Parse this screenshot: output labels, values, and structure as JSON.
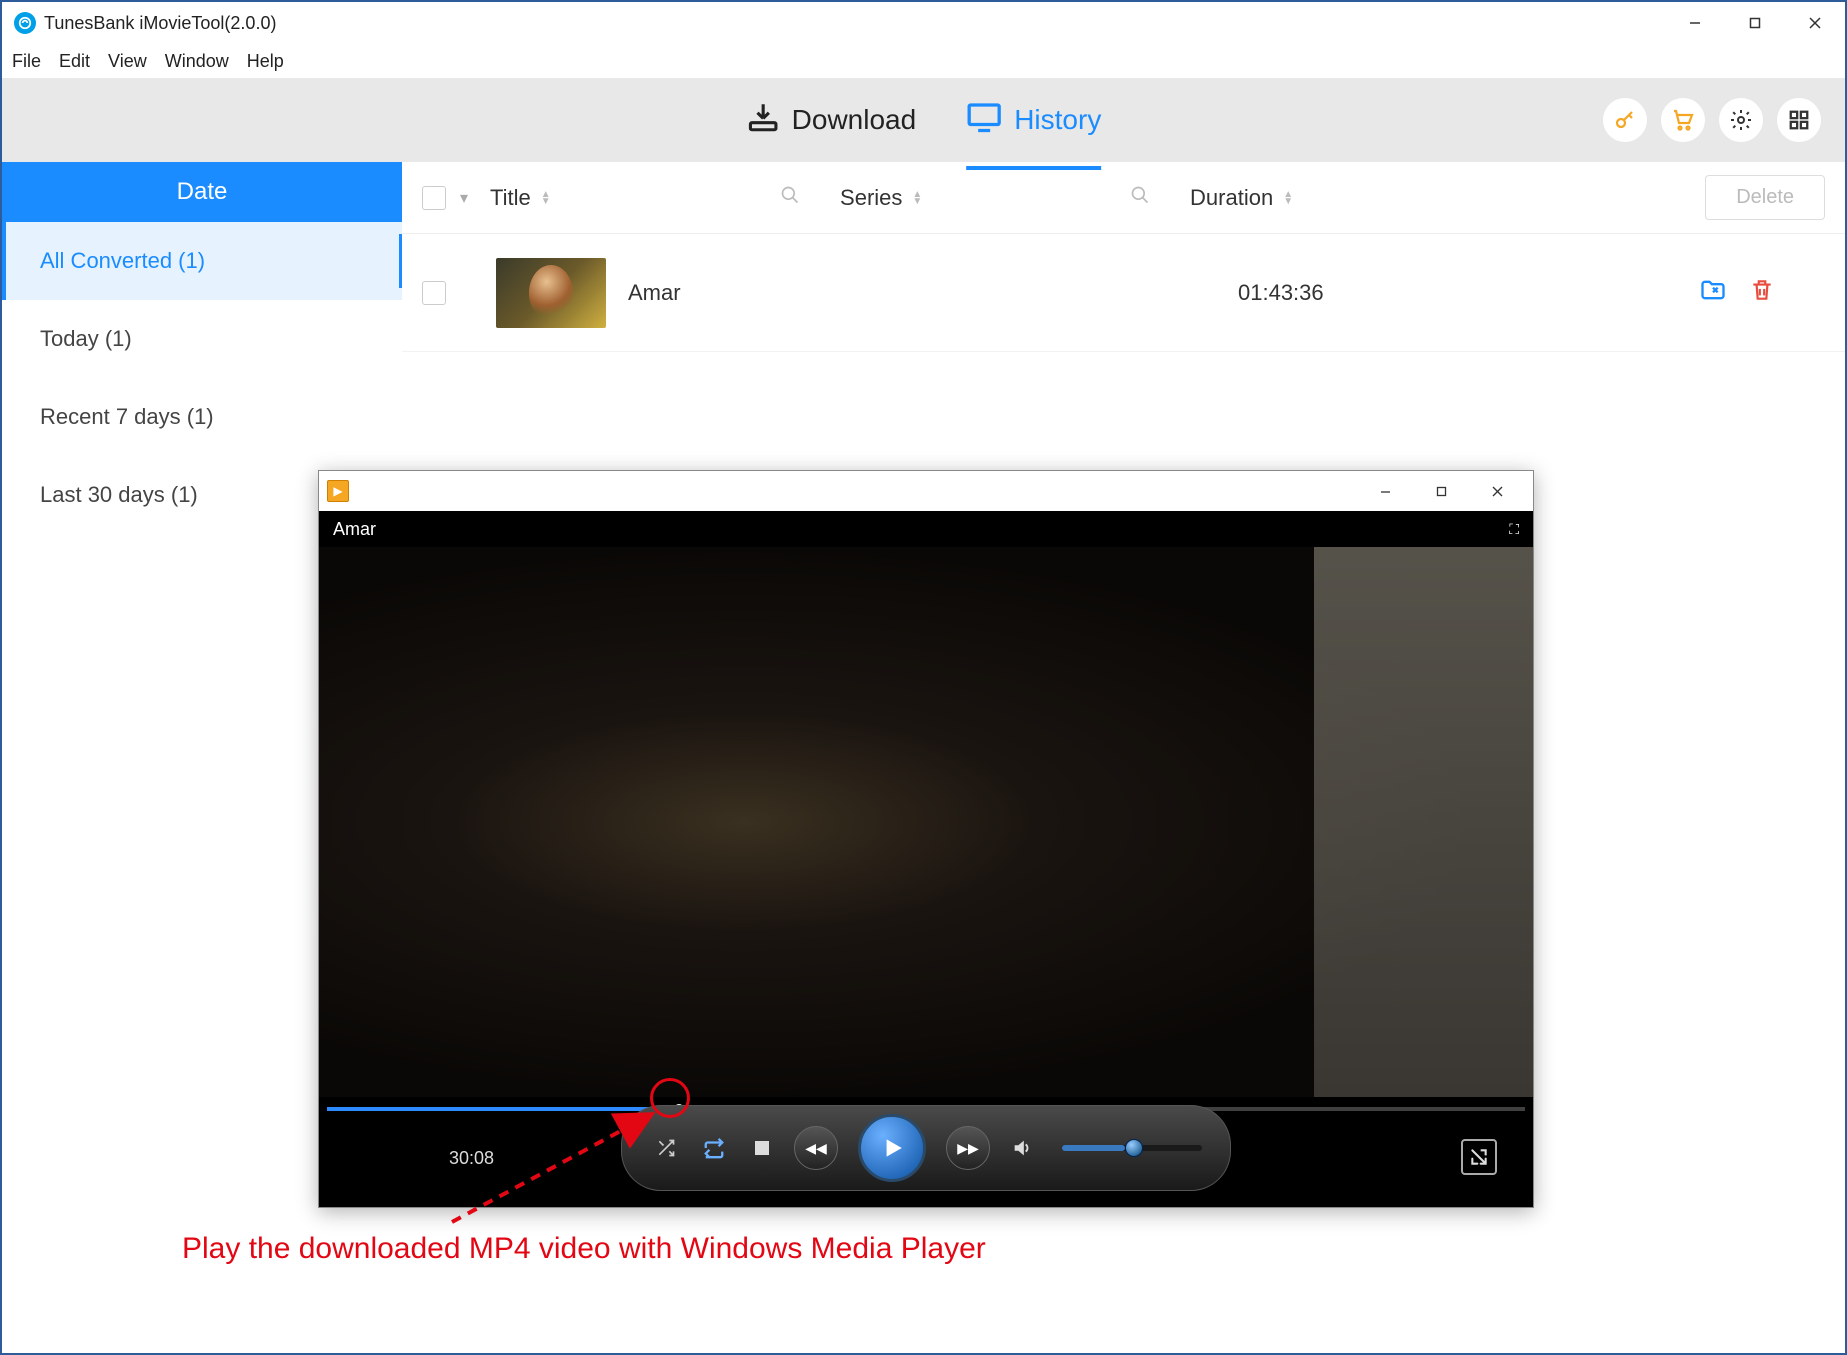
{
  "window": {
    "title": "TunesBank iMovieTool(2.0.0)"
  },
  "menu": {
    "file": "File",
    "edit": "Edit",
    "view": "View",
    "window": "Window",
    "help": "Help"
  },
  "toolbar": {
    "download": "Download",
    "history": "History"
  },
  "sidebar": {
    "header": "Date",
    "items": [
      {
        "label": "All Converted (1)"
      },
      {
        "label": "Today (1)"
      },
      {
        "label": "Recent 7 days (1)"
      },
      {
        "label": "Last 30 days (1)"
      }
    ]
  },
  "table": {
    "columns": {
      "title": "Title",
      "series": "Series",
      "duration": "Duration"
    },
    "delete_label": "Delete",
    "rows": [
      {
        "title": "Amar",
        "series": "",
        "duration": "01:43:36"
      }
    ]
  },
  "player": {
    "video_title": "Amar",
    "current_time": "30:08",
    "progress_percent": 29
  },
  "annotation": {
    "text": "Play the downloaded MP4 video with Windows Media Player"
  }
}
